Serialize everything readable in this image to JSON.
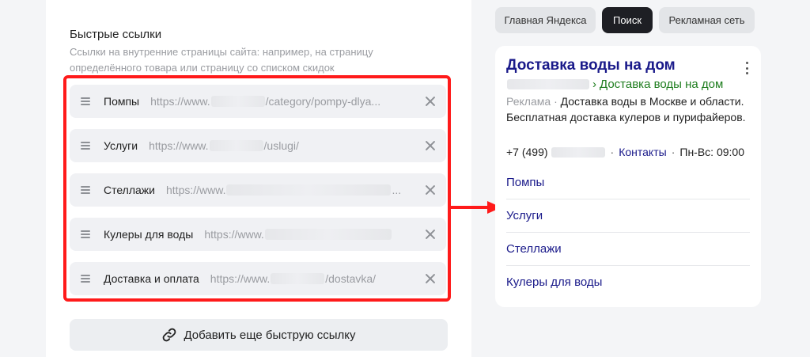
{
  "editor": {
    "section_title": "Быстрые ссылки",
    "section_desc": "Ссылки на внутренние страницы сайта: например, на страницу определённого товара или страницу со списком скидок",
    "links": [
      {
        "label": "Помпы",
        "url_start": "https://www.",
        "url_end": "/category/pompy-dlya..."
      },
      {
        "label": "Услуги",
        "url_start": "https://www.",
        "url_end": "/uslugi/"
      },
      {
        "label": "Стеллажи",
        "url_start": "https://www.",
        "url_end": "..."
      },
      {
        "label": "Кулеры для воды",
        "url_start": "https://www.",
        "url_end": ""
      },
      {
        "label": "Доставка и оплата",
        "url_start": "https://www.",
        "url_end": "/dostavka/"
      }
    ],
    "add_button_label": "Добавить еще быструю ссылку"
  },
  "preview": {
    "tabs": [
      {
        "label": "Главная Яндекса",
        "active": false
      },
      {
        "label": "Поиск",
        "active": true
      },
      {
        "label": "Рекламная сеть",
        "active": false
      }
    ],
    "ad": {
      "title": "Доставка воды на дом",
      "url_path": "Доставка воды на дом",
      "url_separator": "›",
      "label": "Реклама",
      "label_separator": "·",
      "text": "Доставка воды в Москве и области. Бесплатная доставка кулеров и пурифайеров.",
      "phone": "+7 (499)",
      "contacts_link": "Контакты",
      "hours": "Пн-Вс: 09:00",
      "dot": "·",
      "sitelinks": [
        "Помпы",
        "Услуги",
        "Стеллажи",
        "Кулеры для воды"
      ]
    }
  },
  "colors": {
    "highlight_frame": "#ff1a1a",
    "arrow": "#ff1a1a",
    "ad_title": "#1a1a8a",
    "ad_url": "#1e7d1e",
    "active_tab": "#1e1f24"
  },
  "icons": {
    "drag_handle": "drag-handle-icon",
    "remove": "close-icon",
    "add_link": "link-icon",
    "menu": "kebab-menu-icon"
  }
}
